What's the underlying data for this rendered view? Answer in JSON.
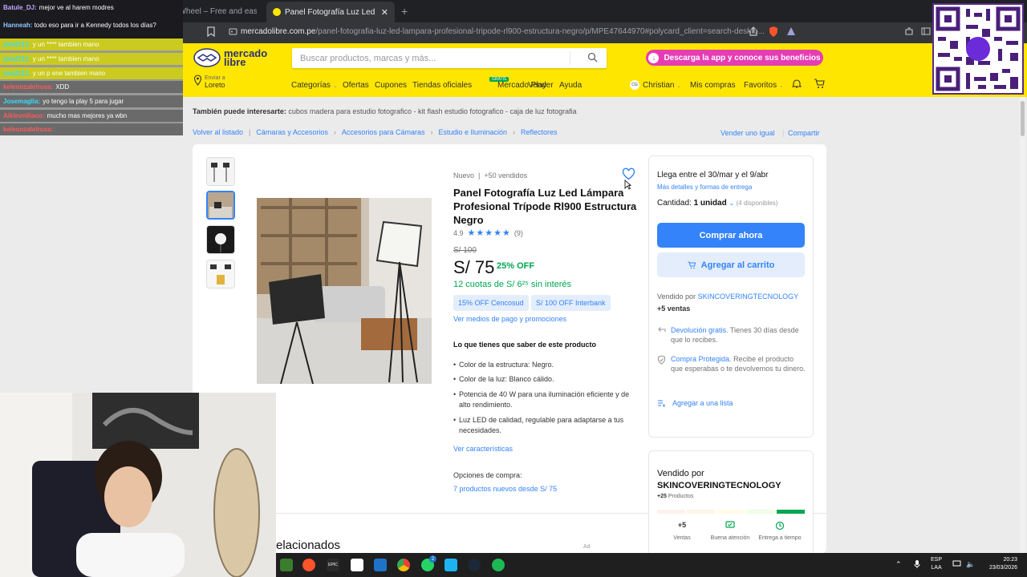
{
  "browser": {
    "tabs": [
      {
        "label": "Spin the Wheel – Free and easy-to-u"
      },
      {
        "label": "Panel Fotografía Luz Led Lámpar"
      }
    ],
    "url_host": "mercadolibre.com.pe",
    "url_path": "/panel-fotografia-luz-led-lampara-profesional-tripode-rl900-estructura-negro/p/MPE47644970#polycard_client=search-deskto..."
  },
  "header": {
    "logo_line1": "mercado",
    "logo_line2": "libre",
    "search_placeholder": "Buscar productos, marcas y más...",
    "promo": "Descarga la app y conoce sus beneficios",
    "location_label": "Enviar a",
    "location_value": "Loreto",
    "nav": [
      "Categorías",
      "Ofertas",
      "Cupones",
      "Tiendas oficiales",
      "Mercado Play",
      "Vender",
      "Ayuda"
    ],
    "nav_badge": "GRATIS",
    "user_initials": "CG",
    "user_name": "Christian",
    "mis_compras": "Mis compras",
    "favoritos": "Favoritos"
  },
  "related_searches": {
    "label": "También puede interesarte:",
    "items": "cubos madera para estudio fotografico - kit flash estudio fotografico - caja de luz fotografia"
  },
  "breadcrumb": {
    "back": "Volver al listado",
    "items": [
      "Cámaras y Accesorios",
      "Accesorios para Cámaras",
      "Estudio e Iluminación",
      "Reflectores"
    ],
    "sell_same": "Vender uno igual",
    "share": "Compartir"
  },
  "product": {
    "condition": "Nuevo  |  +50 vendidos",
    "title": "Panel Fotografía Luz Led Lámpara Profesional Trípode Rl900 Estructura Negro",
    "rating": "4.9",
    "rating_value": 4.9,
    "reviews": "(9)",
    "old_price": "S/ 100",
    "price": "S/ 75",
    "discount": "25% OFF",
    "installments": "12 cuotas de S/ 6²⁵ sin interés",
    "promo1": "15% OFF Cencosud",
    "promo2": "S/ 100 OFF Interbank",
    "payment_link": "Ver medios de pago y promociones",
    "features_title": "Lo que tienes que saber de este producto",
    "features": [
      "Color de la estructura: Negro.",
      "Color de la luz: Blanco cálido.",
      "Potencia de 40 W para una iluminación eficiente y de alto rendimiento.",
      "Luz LED de calidad, regulable para adaptarse a tus necesidades."
    ],
    "see_features": "Ver características",
    "buy_options_label": "Opciones de compra:",
    "buy_options_link": "7 productos nuevos desde S/ 75",
    "related_heading": "elacionados",
    "ad_label": "Ad"
  },
  "buybox": {
    "delivery": "Llega entre el 30/mar y el 9/abr",
    "delivery_link": "Más detalles y formas de entrega",
    "qty_label": "Cantidad:",
    "qty_value": "1 unidad",
    "qty_avail": "(4 disponibles)",
    "buy_now": "Comprar ahora",
    "add_cart": "Agregar al carrito",
    "sold_by_prefix": "Vendido por",
    "seller": "SKINCOVERINGTECNOLOGY",
    "sales": "+5 ventas",
    "return_link": "Devolución gratis.",
    "return_text": "Tienes 30 días desde que lo recibes.",
    "protect_link": "Compra Protegida.",
    "protect_text": "Recibe el producto que esperabas o te devolvemos tu dinero.",
    "add_list": "Agregar a una lista"
  },
  "seller_card": {
    "title_prefix": "Vendido por",
    "title": "SKINCOVERINGTECNOLOGY",
    "products": "+25",
    "products_label": "Productos",
    "stat1_value": "+5",
    "stat1_label": "Ventas",
    "stat2_label": "Buena atención",
    "stat3_label": "Entrega a tiempo"
  },
  "chat": [
    {
      "user": "Batule_DJ:",
      "msg": "mejor ve al harem modres"
    },
    {
      "user": "Hanneah:",
      "msg": "todo eso para ir a Kennedy todos los días?"
    },
    {
      "user": "jota2111:",
      "msg": "y un **** tambien mano"
    },
    {
      "user": "jota2111:",
      "msg": "y un **** tambien mano"
    },
    {
      "user": "jota2111:",
      "msg": "y un p ene tambien mano"
    },
    {
      "user": "keleonzalelrusa:",
      "msg": "XDD"
    },
    {
      "user": "Josemaglia:",
      "msg": "yo tengo la play 5 para jugar"
    },
    {
      "user": "Aiklevniliaco:",
      "msg": "mucho mas mejores ya wbn"
    },
    {
      "user": "keleonzalelrusa:",
      "msg": ""
    }
  ],
  "taskbar": {
    "lang1": "ESP",
    "lang2": "LAA",
    "time": "20:23",
    "date": "23/03/2026",
    "whatsapp_badge": "2"
  },
  "colors": {
    "ml_yellow": "#ffe600",
    "ml_blue": "#3483fa",
    "green": "#00a650",
    "promo_pink": "#e63db4"
  }
}
